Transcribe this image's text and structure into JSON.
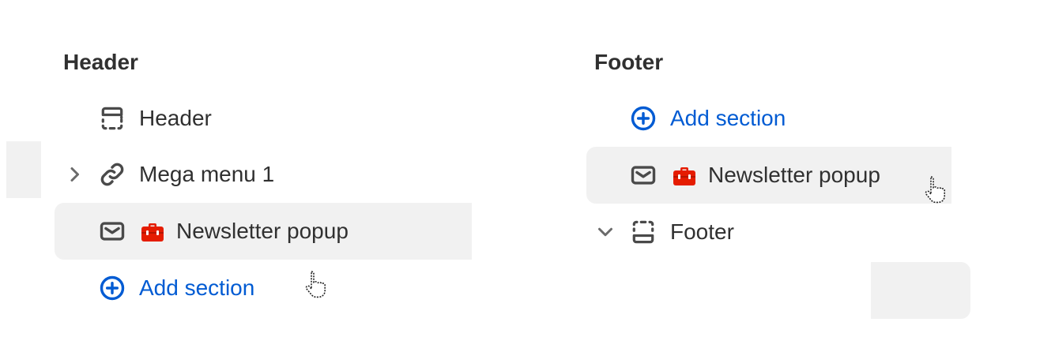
{
  "header_group": {
    "title": "Header",
    "items": [
      {
        "label": "Header",
        "icon": "header-layout-icon"
      },
      {
        "label": "Mega menu 1",
        "icon": "link-icon",
        "has_chevron": true
      },
      {
        "label": "Newsletter popup",
        "icon": "mail-icon",
        "badge_icon": "app-toolbox-icon"
      }
    ],
    "add_section_label": "Add section"
  },
  "footer_group": {
    "title": "Footer",
    "add_section_label": "Add section",
    "items": [
      {
        "label": "Newsletter popup",
        "icon": "mail-icon",
        "badge_icon": "app-toolbox-icon"
      },
      {
        "label": "Footer",
        "icon": "footer-layout-icon",
        "has_chevron": true
      }
    ]
  },
  "colors": {
    "text": "#303030",
    "link": "#005bd3",
    "highlight": "#f1f1f1",
    "badge": "#e51c00"
  }
}
